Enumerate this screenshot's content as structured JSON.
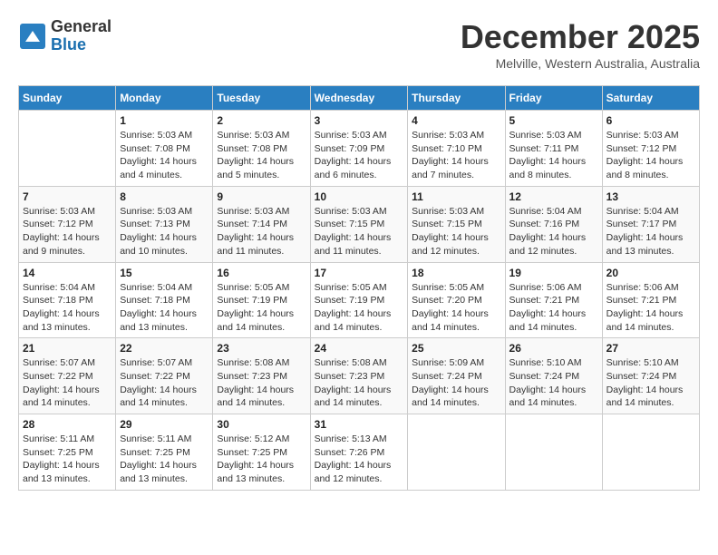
{
  "header": {
    "logo_general": "General",
    "logo_blue": "Blue",
    "month_title": "December 2025",
    "subtitle": "Melville, Western Australia, Australia"
  },
  "days_of_week": [
    "Sunday",
    "Monday",
    "Tuesday",
    "Wednesday",
    "Thursday",
    "Friday",
    "Saturday"
  ],
  "weeks": [
    [
      {
        "day": "",
        "info": ""
      },
      {
        "day": "1",
        "info": "Sunrise: 5:03 AM\nSunset: 7:08 PM\nDaylight: 14 hours\nand 4 minutes."
      },
      {
        "day": "2",
        "info": "Sunrise: 5:03 AM\nSunset: 7:08 PM\nDaylight: 14 hours\nand 5 minutes."
      },
      {
        "day": "3",
        "info": "Sunrise: 5:03 AM\nSunset: 7:09 PM\nDaylight: 14 hours\nand 6 minutes."
      },
      {
        "day": "4",
        "info": "Sunrise: 5:03 AM\nSunset: 7:10 PM\nDaylight: 14 hours\nand 7 minutes."
      },
      {
        "day": "5",
        "info": "Sunrise: 5:03 AM\nSunset: 7:11 PM\nDaylight: 14 hours\nand 8 minutes."
      },
      {
        "day": "6",
        "info": "Sunrise: 5:03 AM\nSunset: 7:12 PM\nDaylight: 14 hours\nand 8 minutes."
      }
    ],
    [
      {
        "day": "7",
        "info": "Sunrise: 5:03 AM\nSunset: 7:12 PM\nDaylight: 14 hours\nand 9 minutes."
      },
      {
        "day": "8",
        "info": "Sunrise: 5:03 AM\nSunset: 7:13 PM\nDaylight: 14 hours\nand 10 minutes."
      },
      {
        "day": "9",
        "info": "Sunrise: 5:03 AM\nSunset: 7:14 PM\nDaylight: 14 hours\nand 11 minutes."
      },
      {
        "day": "10",
        "info": "Sunrise: 5:03 AM\nSunset: 7:15 PM\nDaylight: 14 hours\nand 11 minutes."
      },
      {
        "day": "11",
        "info": "Sunrise: 5:03 AM\nSunset: 7:15 PM\nDaylight: 14 hours\nand 12 minutes."
      },
      {
        "day": "12",
        "info": "Sunrise: 5:04 AM\nSunset: 7:16 PM\nDaylight: 14 hours\nand 12 minutes."
      },
      {
        "day": "13",
        "info": "Sunrise: 5:04 AM\nSunset: 7:17 PM\nDaylight: 14 hours\nand 13 minutes."
      }
    ],
    [
      {
        "day": "14",
        "info": "Sunrise: 5:04 AM\nSunset: 7:18 PM\nDaylight: 14 hours\nand 13 minutes."
      },
      {
        "day": "15",
        "info": "Sunrise: 5:04 AM\nSunset: 7:18 PM\nDaylight: 14 hours\nand 13 minutes."
      },
      {
        "day": "16",
        "info": "Sunrise: 5:05 AM\nSunset: 7:19 PM\nDaylight: 14 hours\nand 14 minutes."
      },
      {
        "day": "17",
        "info": "Sunrise: 5:05 AM\nSunset: 7:19 PM\nDaylight: 14 hours\nand 14 minutes."
      },
      {
        "day": "18",
        "info": "Sunrise: 5:05 AM\nSunset: 7:20 PM\nDaylight: 14 hours\nand 14 minutes."
      },
      {
        "day": "19",
        "info": "Sunrise: 5:06 AM\nSunset: 7:21 PM\nDaylight: 14 hours\nand 14 minutes."
      },
      {
        "day": "20",
        "info": "Sunrise: 5:06 AM\nSunset: 7:21 PM\nDaylight: 14 hours\nand 14 minutes."
      }
    ],
    [
      {
        "day": "21",
        "info": "Sunrise: 5:07 AM\nSunset: 7:22 PM\nDaylight: 14 hours\nand 14 minutes."
      },
      {
        "day": "22",
        "info": "Sunrise: 5:07 AM\nSunset: 7:22 PM\nDaylight: 14 hours\nand 14 minutes."
      },
      {
        "day": "23",
        "info": "Sunrise: 5:08 AM\nSunset: 7:23 PM\nDaylight: 14 hours\nand 14 minutes."
      },
      {
        "day": "24",
        "info": "Sunrise: 5:08 AM\nSunset: 7:23 PM\nDaylight: 14 hours\nand 14 minutes."
      },
      {
        "day": "25",
        "info": "Sunrise: 5:09 AM\nSunset: 7:24 PM\nDaylight: 14 hours\nand 14 minutes."
      },
      {
        "day": "26",
        "info": "Sunrise: 5:10 AM\nSunset: 7:24 PM\nDaylight: 14 hours\nand 14 minutes."
      },
      {
        "day": "27",
        "info": "Sunrise: 5:10 AM\nSunset: 7:24 PM\nDaylight: 14 hours\nand 14 minutes."
      }
    ],
    [
      {
        "day": "28",
        "info": "Sunrise: 5:11 AM\nSunset: 7:25 PM\nDaylight: 14 hours\nand 13 minutes."
      },
      {
        "day": "29",
        "info": "Sunrise: 5:11 AM\nSunset: 7:25 PM\nDaylight: 14 hours\nand 13 minutes."
      },
      {
        "day": "30",
        "info": "Sunrise: 5:12 AM\nSunset: 7:25 PM\nDaylight: 14 hours\nand 13 minutes."
      },
      {
        "day": "31",
        "info": "Sunrise: 5:13 AM\nSunset: 7:26 PM\nDaylight: 14 hours\nand 12 minutes."
      },
      {
        "day": "",
        "info": ""
      },
      {
        "day": "",
        "info": ""
      },
      {
        "day": "",
        "info": ""
      }
    ]
  ]
}
